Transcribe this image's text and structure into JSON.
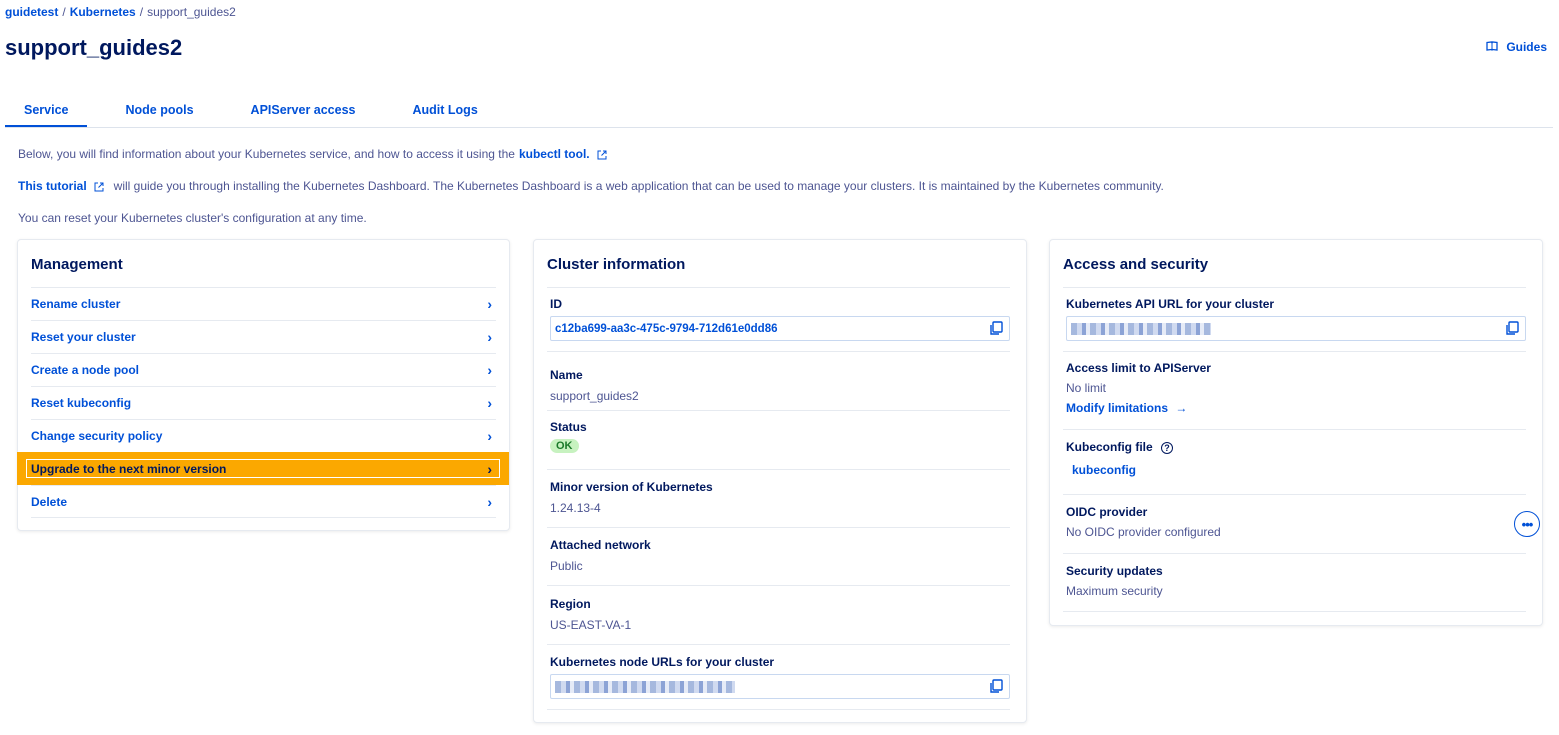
{
  "breadcrumb": {
    "items": [
      {
        "label": "guidetest",
        "link": true
      },
      {
        "label": "Kubernetes",
        "link": true
      },
      {
        "label": "support_guides2",
        "link": false
      }
    ],
    "separator": "/"
  },
  "page_title": "support_guides2",
  "header": {
    "guides_label": "Guides",
    "guides_icon": "book-icon"
  },
  "tabs": [
    {
      "label": "Service",
      "active": true
    },
    {
      "label": "Node pools",
      "active": false
    },
    {
      "label": "APIServer access",
      "active": false
    },
    {
      "label": "Audit Logs",
      "active": false
    }
  ],
  "intro": {
    "line1_text": "Below, you will find information about your Kubernetes service, and how to access it using the",
    "line1_link": "kubectl tool.",
    "line2_link": "This tutorial",
    "line2_text": "will guide you through installing the Kubernetes Dashboard. The Kubernetes Dashboard is a web application that can be used to manage your clusters. It is maintained by the Kubernetes community.",
    "line3_text": "You can reset your Kubernetes cluster's configuration at any time."
  },
  "management": {
    "title": "Management",
    "items": [
      {
        "label": "Rename cluster"
      },
      {
        "label": "Reset your cluster"
      },
      {
        "label": "Create a node pool"
      },
      {
        "label": "Reset kubeconfig"
      },
      {
        "label": "Change security policy"
      },
      {
        "label": "Upgrade to the next minor version",
        "highlighted": true
      },
      {
        "label": "Delete"
      }
    ]
  },
  "cluster_info": {
    "title": "Cluster information",
    "id_label": "ID",
    "id_value": "c12ba699-aa3c-475c-9794-712d61e0dd86",
    "name_label": "Name",
    "name_value": "support_guides2",
    "status_label": "Status",
    "status_value": "OK",
    "version_label": "Minor version of Kubernetes",
    "version_value": "1.24.13-4",
    "network_label": "Attached network",
    "network_value": "Public",
    "region_label": "Region",
    "region_value": "US-EAST-VA-1",
    "node_urls_label": "Kubernetes node URLs for your cluster"
  },
  "access_security": {
    "title": "Access and security",
    "api_url_label": "Kubernetes API URL for your cluster",
    "access_limit_label": "Access limit to APIServer",
    "access_limit_value": "No limit",
    "modify_link": "Modify limitations",
    "kubeconfig_label": "Kubeconfig file",
    "kubeconfig_link": "kubeconfig",
    "oidc_label": "OIDC provider",
    "oidc_value": "No OIDC provider configured",
    "security_updates_label": "Security updates",
    "security_updates_value": "Maximum security"
  },
  "colors": {
    "link": "#0050d7",
    "heading": "#00185e",
    "text": "#4d5592",
    "highlight": "#fba800",
    "ok_badge": "#c7f2c0"
  }
}
